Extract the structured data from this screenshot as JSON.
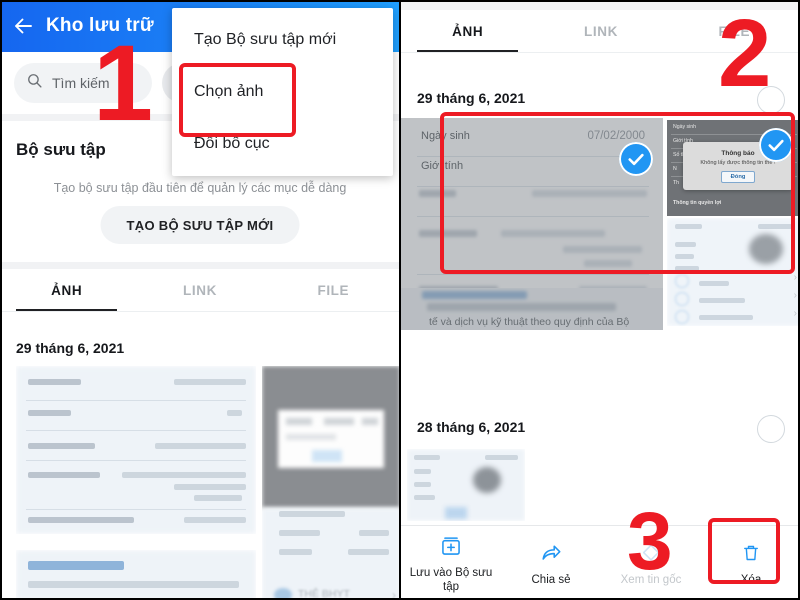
{
  "left_phone": {
    "appbar": {
      "back_icon": "back-arrow-icon",
      "title": "Kho lưu trữ"
    },
    "search": {
      "icon": "search-icon",
      "placeholder": "Tìm kiếm"
    },
    "collection": {
      "heading": "Bộ sưu tập",
      "subtitle": "Tạo bộ sưu tập đầu tiên để quản lý các mục dễ dàng",
      "button_label": "TẠO BỘ SƯU TẬP MỚI"
    },
    "tabs": [
      {
        "label": "ẢNH",
        "active": true
      },
      {
        "label": "LINK",
        "active": false
      },
      {
        "label": "FILE",
        "active": false
      }
    ],
    "date_group": "29 tháng 6, 2021",
    "thumbnail_caption": "THẺ BHYT",
    "menu": {
      "items": [
        {
          "label": "Tạo Bộ sưu tập mới"
        },
        {
          "label": "Chọn ảnh"
        },
        {
          "label": "Đổi bố cục"
        }
      ]
    }
  },
  "right_phone": {
    "tabs": [
      {
        "label": "ẢNH",
        "active": true
      },
      {
        "label": "LINK",
        "active": false
      },
      {
        "label": "FILE",
        "active": false
      }
    ],
    "date_groups": [
      {
        "label": "29 tháng 6, 2021",
        "checked": false
      },
      {
        "label": "28 tháng 6, 2021",
        "checked": false
      }
    ],
    "selected_photo_left": {
      "field_label_1": "Ngày sinh",
      "field_value_1": "07/02/2000",
      "field_label_2": "Giới tính",
      "footer_text": "tế và dịch vụ kỹ thuật theo quy định của Bộ",
      "selected": true,
      "check_icon": "check-circle-icon"
    },
    "selected_photo_right": {
      "field_label_1": "Ngày sinh",
      "field_label_2": "Giới tính",
      "field_label_3": "Số thẻ BHYT",
      "field_label_4": "Thông tin quyền lợi",
      "dialog": {
        "title": "Thông báo",
        "message": "Không lấy được thông tin thẻ !",
        "button_label": "Đóng"
      },
      "selected": true,
      "check_icon": "check-circle-icon"
    },
    "action_bar": [
      {
        "label": "Lưu vào Bộ sưu tập",
        "icon": "add-to-collection-icon",
        "disabled": false
      },
      {
        "label": "Chia sẻ",
        "icon": "share-icon",
        "disabled": false
      },
      {
        "label": "Xem tin gốc",
        "icon": "view-source-icon",
        "disabled": true
      },
      {
        "label": "Xóa",
        "icon": "trash-icon",
        "disabled": false
      }
    ]
  },
  "annotations": {
    "step1": "1",
    "step2": "2",
    "step3": "3",
    "color": "#ed1b24"
  }
}
